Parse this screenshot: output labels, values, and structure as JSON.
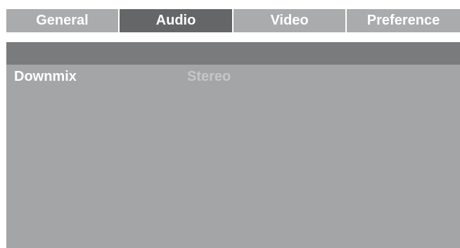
{
  "tabs": [
    {
      "label": "General",
      "active": false
    },
    {
      "label": "Audio",
      "active": true
    },
    {
      "label": "Video",
      "active": false
    },
    {
      "label": "Preference",
      "active": false
    }
  ],
  "settings": [
    {
      "label": "Downmix",
      "value": "Stereo"
    }
  ],
  "colors": {
    "tab_inactive": "#a9abad",
    "tab_active": "#646668",
    "panel_background": "#a3a5a7",
    "panel_header": "#797b7d",
    "label_text": "#ffffff",
    "value_text": "#c4c6c8"
  }
}
